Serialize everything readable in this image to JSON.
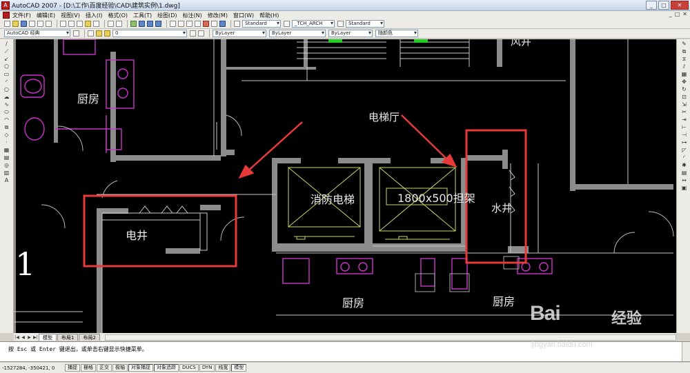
{
  "window": {
    "title": "AutoCAD 2007 - [D:\\工作\\百度经验\\CAD\\建筑实例\\1.dwg]",
    "minimize": "_",
    "maximize": "□",
    "close": "✕"
  },
  "menu": {
    "items": [
      "文件(F)",
      "编辑(E)",
      "视图(V)",
      "插入(I)",
      "格式(O)",
      "工具(T)",
      "绘图(D)",
      "标注(N)",
      "修改(M)",
      "窗口(W)",
      "帮助(H)"
    ],
    "doc_controls": [
      "_",
      "□",
      "✕"
    ]
  },
  "toolbar": {
    "text_style": "Standard",
    "dim_style": "_TCH_ARCH",
    "table_style": "Standard",
    "workspace": "AutoCAD 经典",
    "layer": "0",
    "color": "ByLayer",
    "linetype": "ByLayer",
    "lineweight": "ByLayer",
    "plotstyle": "随颜色"
  },
  "drawing": {
    "labels": {
      "kitchen_top": "厨房",
      "elevator_hall": "电梯厅",
      "fire_elevator": "消防电梯",
      "stretcher": "1800x500担架",
      "electric_shaft": "电井",
      "water_shaft": "水井",
      "wind_shaft": "风井",
      "kitchen_bottom_left": "厨房",
      "kitchen_bottom_right": "厨房",
      "step_number": "1"
    }
  },
  "tabs": {
    "nav": [
      "|◀",
      "◀",
      "▶",
      "▶|"
    ],
    "items": [
      "模型",
      "布局1",
      "布局2"
    ]
  },
  "command": {
    "history": "按 Esc 或 Enter 键退出，或单击右键显示快捷菜单。",
    "prompt": ""
  },
  "status": {
    "coords": "-1527284, -350421, 0",
    "buttons": [
      "捕捉",
      "栅格",
      "正交",
      "极轴",
      "对象捕捉",
      "对象追踪",
      "DUCS",
      "DYN",
      "线宽",
      "模型"
    ]
  },
  "watermark": {
    "logo": "Bai",
    "text": "经验",
    "url": "jingyan.baidu.com"
  }
}
